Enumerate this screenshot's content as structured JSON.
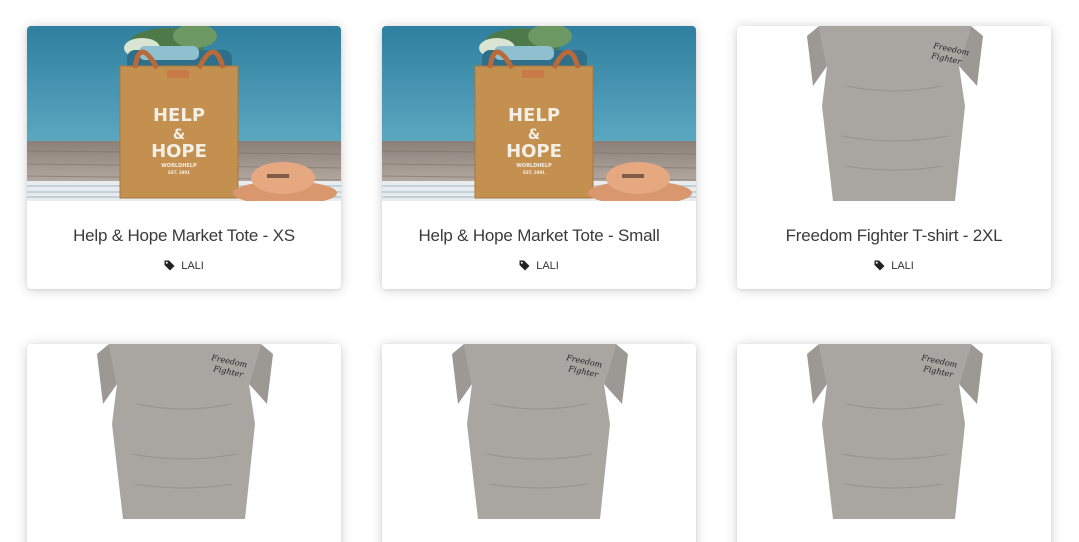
{
  "products": [
    {
      "title": "Help & Hope Market Tote - XS",
      "vendor": "LALI",
      "image": "tote-bag",
      "bag_lines": [
        "HELP",
        "&",
        "HOPE"
      ],
      "bag_sub": "WORLDHELP",
      "bag_sub2": "EST. 1991"
    },
    {
      "title": "Help & Hope Market Tote - Small",
      "vendor": "LALI",
      "image": "tote-bag",
      "bag_lines": [
        "HELP",
        "&",
        "HOPE"
      ],
      "bag_sub": "WORLDHELP",
      "bag_sub2": "EST. 1991"
    },
    {
      "title": "Freedom Fighter T-shirt - 2XL",
      "vendor": "LALI",
      "image": "grey-tshirt",
      "shirt_text": [
        "Freedom",
        "Fighter"
      ]
    },
    {
      "title": "",
      "vendor": "",
      "image": "grey-tshirt",
      "shirt_text": [
        "Freedom",
        "Fighter"
      ]
    },
    {
      "title": "",
      "vendor": "",
      "image": "grey-tshirt",
      "shirt_text": [
        "Freedom",
        "Fighter"
      ]
    },
    {
      "title": "",
      "vendor": "",
      "image": "grey-tshirt",
      "shirt_text": [
        "Freedom",
        "Fighter"
      ]
    }
  ],
  "icons": {
    "vendor_tag": "tag-icon"
  },
  "colors": {
    "card_bg": "#ffffff",
    "title_text": "#3a3a3a",
    "water": "#3e8fae",
    "dock": "#9a8f86",
    "jute": "#c8925a",
    "shirt": "#a7a39f"
  }
}
